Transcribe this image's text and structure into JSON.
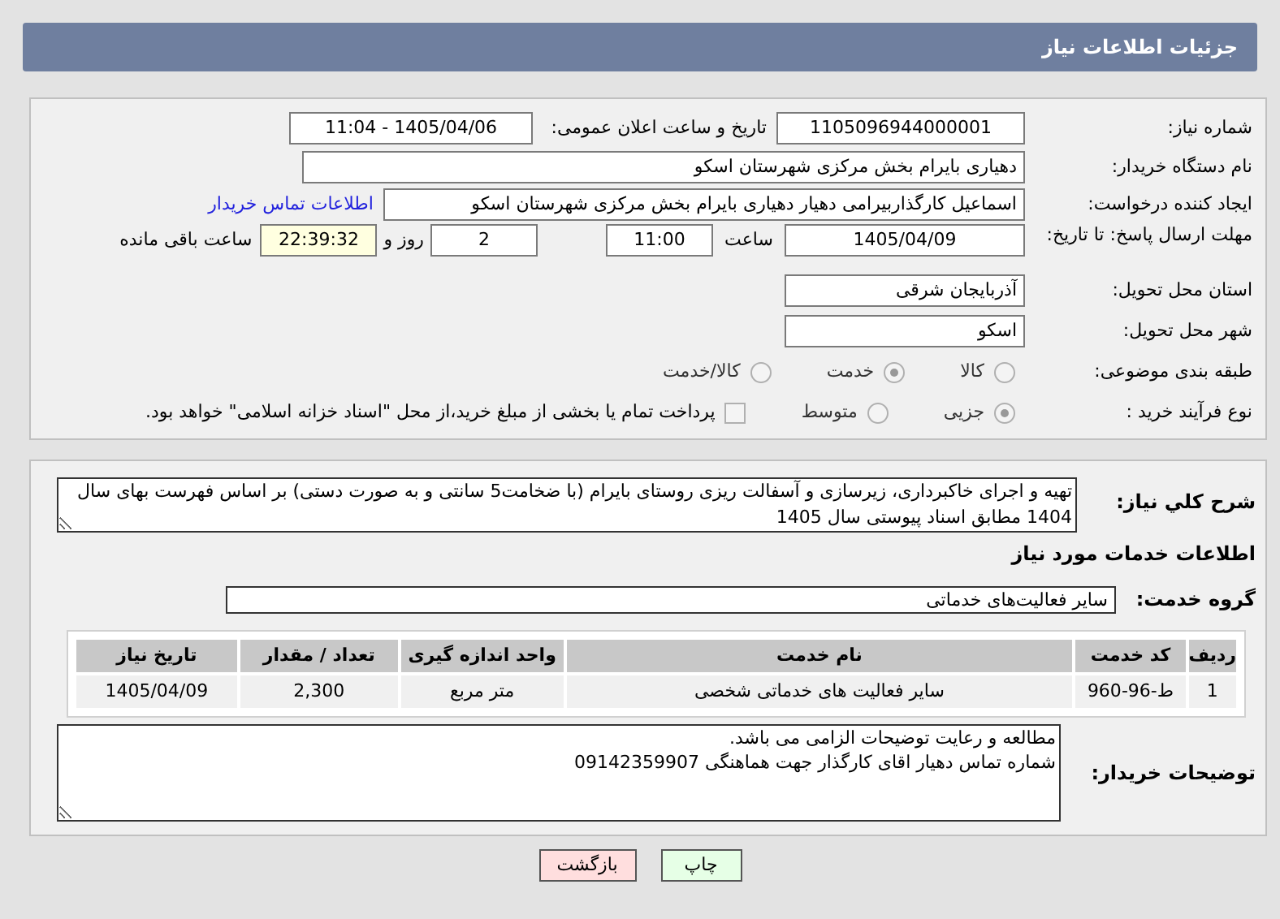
{
  "header": {
    "title": "جزئیات اطلاعات نیاز"
  },
  "need_number": {
    "label": "شماره نیاز:",
    "value": "1105096944000001"
  },
  "announce": {
    "label": "تاریخ و ساعت اعلان عمومی:",
    "value": "1405/04/06 - 11:04"
  },
  "buyer_org": {
    "label": "نام دستگاه خریدار:",
    "value": "دهیاری بایرام بخش مرکزی شهرستان اسکو"
  },
  "requester": {
    "label": "ایجاد کننده درخواست:",
    "value": "اسماعیل کارگذاربیرامی دهیار دهیاری بایرام بخش مرکزی شهرستان اسکو",
    "link": "اطلاعات تماس خریدار"
  },
  "deadline": {
    "label": "مهلت ارسال پاسخ: تا تاریخ:",
    "date": "1405/04/09",
    "time_label": "ساعت",
    "time": "11:00",
    "days": "2",
    "days_label": "روز و",
    "remaining": "22:39:32",
    "remaining_label": "ساعت باقی مانده"
  },
  "province": {
    "label": "استان محل تحویل:",
    "value": "آذربایجان شرقی"
  },
  "city": {
    "label": "شهر محل تحویل:",
    "value": "اسکو"
  },
  "category": {
    "label": "طبقه بندی موضوعی:",
    "options": [
      {
        "label": "کالا",
        "selected": false
      },
      {
        "label": "خدمت",
        "selected": true
      },
      {
        "label": "کالا/خدمت",
        "selected": false
      }
    ]
  },
  "process": {
    "label": "نوع فرآیند خرید :",
    "options": [
      {
        "label": "جزیی",
        "selected": true
      },
      {
        "label": "متوسط",
        "selected": false
      }
    ],
    "payment": {
      "checked": false,
      "text": "پرداخت تمام یا بخشی از مبلغ خرید،از محل \"اسناد خزانه اسلامی\" خواهد بود."
    }
  },
  "description": {
    "label": "شرح کلي نیاز:",
    "text": "تهیه و اجرای خاکبرداری، زیرسازی و آسفالت ریزی روستای بایرام (با ضخامت5 سانتی و به صورت دستی) بر اساس فهرست بهای سال 1404 مطابق اسناد پیوستی سال 1405"
  },
  "services_heading": "اطلاعات خدمات مورد نیاز",
  "service_group": {
    "label": "گروه خدمت:",
    "value": "سایر فعالیت‌های خدماتی"
  },
  "table": {
    "columns": [
      "ردیف",
      "کد خدمت",
      "نام خدمت",
      "واحد اندازه گیری",
      "تعداد / مقدار",
      "تاریخ نیاز"
    ],
    "rows": [
      [
        "1",
        "ط-96-960",
        "سایر فعالیت های خدماتی شخصی",
        "متر مربع",
        "2,300",
        "1405/04/09"
      ]
    ]
  },
  "buyer_notes": {
    "label": "توضیحات خریدار:",
    "text": "مطالعه و رعایت توضیحات الزامی می باشد.\nشماره تماس دهیار اقای کارگذار جهت هماهنگی 09142359907"
  },
  "buttons": [
    {
      "label": "چاپ",
      "kind": "print"
    },
    {
      "label": "بازگشت",
      "kind": "back"
    }
  ]
}
